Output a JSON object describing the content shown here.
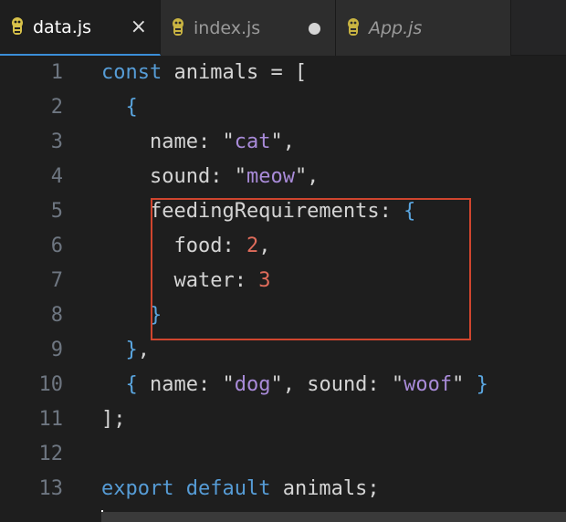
{
  "tabs": [
    {
      "label": "data.js",
      "active": true,
      "close": "×"
    },
    {
      "label": "index.js",
      "active": false,
      "dirty": true
    },
    {
      "label": "App.js",
      "active": false,
      "italic": true
    }
  ],
  "colors": {
    "keyword": "#569cd6",
    "string": "#a98bd9",
    "number": "#e06c5b",
    "highlight_border": "#d0452e",
    "active_tab_underline": "#3b8ed8"
  },
  "code_lines": [
    {
      "number": "1",
      "tokens": [
        {
          "t": "const",
          "k": "keyword"
        },
        {
          "t": " animals = [",
          "k": "ident"
        }
      ]
    },
    {
      "number": "2",
      "tokens": [
        {
          "t": "  ",
          "k": "ident"
        },
        {
          "t": "{",
          "k": "brace"
        }
      ]
    },
    {
      "number": "3",
      "tokens": [
        {
          "t": "    name: ",
          "k": "prop"
        },
        {
          "t": "\"",
          "k": "quote"
        },
        {
          "t": "cat",
          "k": "string"
        },
        {
          "t": "\",",
          "k": "quote"
        }
      ]
    },
    {
      "number": "4",
      "tokens": [
        {
          "t": "    sound: ",
          "k": "prop"
        },
        {
          "t": "\"",
          "k": "quote"
        },
        {
          "t": "meow",
          "k": "string"
        },
        {
          "t": "\",",
          "k": "quote"
        }
      ]
    },
    {
      "number": "5",
      "tokens": [
        {
          "t": "    feedingRequirements: ",
          "k": "prop"
        },
        {
          "t": "{",
          "k": "brace"
        }
      ]
    },
    {
      "number": "6",
      "tokens": [
        {
          "t": "      food: ",
          "k": "prop"
        },
        {
          "t": "2",
          "k": "number"
        },
        {
          "t": ",",
          "k": "punct"
        }
      ]
    },
    {
      "number": "7",
      "tokens": [
        {
          "t": "      water: ",
          "k": "prop"
        },
        {
          "t": "3",
          "k": "number"
        }
      ]
    },
    {
      "number": "8",
      "tokens": [
        {
          "t": "    ",
          "k": "ident"
        },
        {
          "t": "}",
          "k": "brace"
        }
      ]
    },
    {
      "number": "9",
      "tokens": [
        {
          "t": "  ",
          "k": "ident"
        },
        {
          "t": "}",
          "k": "brace"
        },
        {
          "t": ",",
          "k": "punct"
        }
      ]
    },
    {
      "number": "10",
      "tokens": [
        {
          "t": "  ",
          "k": "ident"
        },
        {
          "t": "{",
          "k": "brace"
        },
        {
          "t": " name: ",
          "k": "prop"
        },
        {
          "t": "\"",
          "k": "quote"
        },
        {
          "t": "dog",
          "k": "string"
        },
        {
          "t": "\", sound: ",
          "k": "quote"
        },
        {
          "t": "\"",
          "k": "quote"
        },
        {
          "t": "woof",
          "k": "string"
        },
        {
          "t": "\" ",
          "k": "quote"
        },
        {
          "t": "}",
          "k": "brace"
        }
      ]
    },
    {
      "number": "11",
      "tokens": [
        {
          "t": "];",
          "k": "ident"
        }
      ]
    },
    {
      "number": "12",
      "tokens": []
    },
    {
      "number": "13",
      "tokens": [
        {
          "t": "export",
          "k": "keyword"
        },
        {
          "t": " ",
          "k": "ident"
        },
        {
          "t": "default",
          "k": "keyword"
        },
        {
          "t": " animals;",
          "k": "ident"
        }
      ]
    }
  ]
}
